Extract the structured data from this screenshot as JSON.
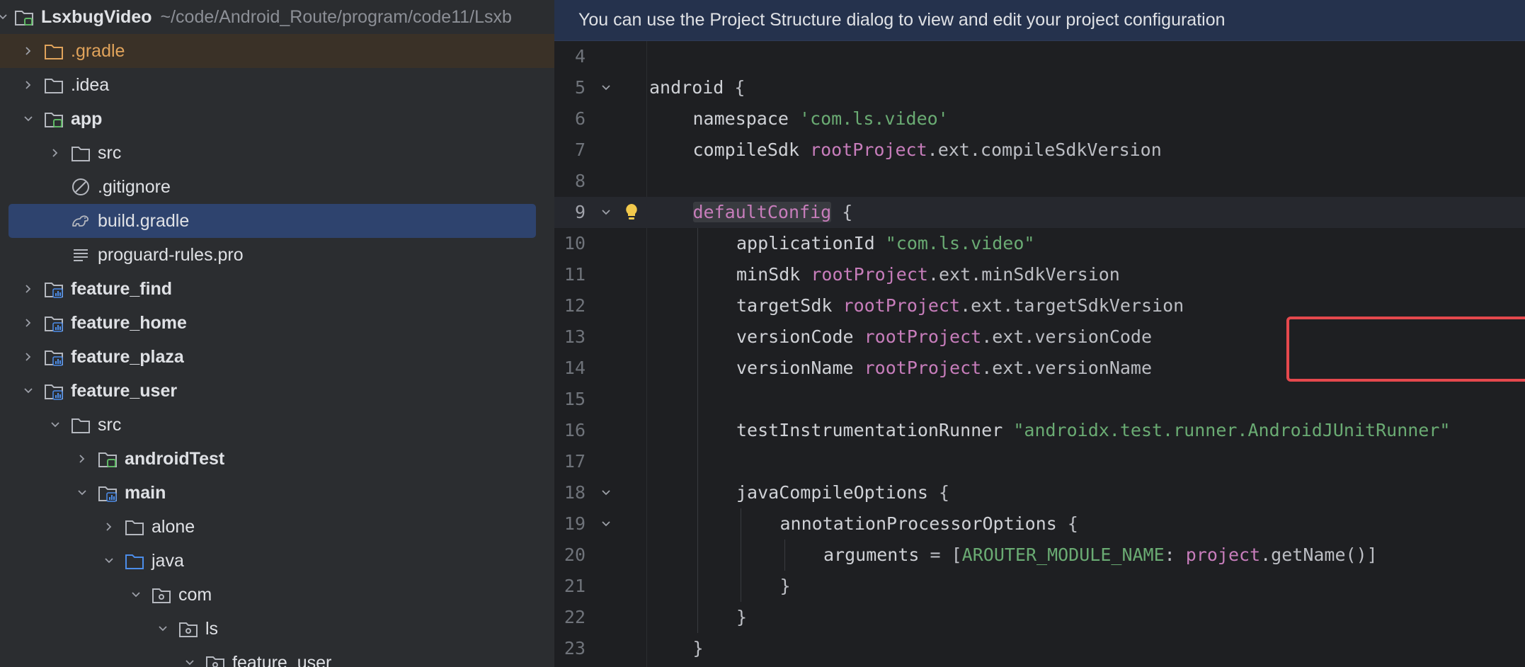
{
  "tree": {
    "root": {
      "label": "LsxbugVideo",
      "path": "~/code/Android_Route/program/code11/Lsxb"
    },
    "items": [
      {
        "label": ".gradle",
        "kind": "folder",
        "indent": 0,
        "expand": "collapsed",
        "style": "gradle"
      },
      {
        "label": ".idea",
        "kind": "folder",
        "indent": 0,
        "expand": "collapsed"
      },
      {
        "label": "app",
        "kind": "module",
        "indent": 0,
        "expand": "expanded",
        "bold": true
      },
      {
        "label": "src",
        "kind": "folder",
        "indent": 1,
        "expand": "collapsed"
      },
      {
        "label": ".gitignore",
        "kind": "ignore",
        "indent": 1,
        "expand": "none"
      },
      {
        "label": "build.gradle",
        "kind": "gradle-file",
        "indent": 1,
        "expand": "none",
        "selected": true
      },
      {
        "label": "proguard-rules.pro",
        "kind": "text-file",
        "indent": 1,
        "expand": "none"
      },
      {
        "label": "feature_find",
        "kind": "lib-module",
        "indent": 0,
        "expand": "collapsed",
        "bold": true
      },
      {
        "label": "feature_home",
        "kind": "lib-module",
        "indent": 0,
        "expand": "collapsed",
        "bold": true
      },
      {
        "label": "feature_plaza",
        "kind": "lib-module",
        "indent": 0,
        "expand": "collapsed",
        "bold": true
      },
      {
        "label": "feature_user",
        "kind": "lib-module",
        "indent": 0,
        "expand": "expanded",
        "bold": true
      },
      {
        "label": "src",
        "kind": "folder",
        "indent": 1,
        "expand": "expanded"
      },
      {
        "label": "androidTest",
        "kind": "test-folder",
        "indent": 2,
        "expand": "collapsed",
        "bold": true
      },
      {
        "label": "main",
        "kind": "lib-module",
        "indent": 2,
        "expand": "expanded",
        "bold": true
      },
      {
        "label": "alone",
        "kind": "folder",
        "indent": 3,
        "expand": "collapsed"
      },
      {
        "label": "java",
        "kind": "source-folder",
        "indent": 3,
        "expand": "expanded"
      },
      {
        "label": "com",
        "kind": "package",
        "indent": 4,
        "expand": "expanded"
      },
      {
        "label": "ls",
        "kind": "package",
        "indent": 5,
        "expand": "expanded"
      },
      {
        "label": "feature_user",
        "kind": "package",
        "indent": 6,
        "expand": "expanded"
      }
    ]
  },
  "editor": {
    "banner": "You can use the Project Structure dialog to view and edit your project configuration",
    "current_line": 9,
    "lines": [
      {
        "n": "4",
        "indent": 0,
        "tokens": []
      },
      {
        "n": "5",
        "indent": 0,
        "fold": true,
        "tokens": [
          [
            "kw",
            "android "
          ],
          [
            "plain",
            "{"
          ]
        ]
      },
      {
        "n": "6",
        "indent": 1,
        "tokens": [
          [
            "kw",
            "namespace "
          ],
          [
            "str",
            "'com.ls.video'"
          ]
        ]
      },
      {
        "n": "7",
        "indent": 1,
        "tokens": [
          [
            "kw",
            "compileSdk "
          ],
          [
            "ident",
            "rootProject"
          ],
          [
            "plain",
            ".ext.compileSdkVersion"
          ]
        ]
      },
      {
        "n": "8",
        "indent": 0,
        "tokens": []
      },
      {
        "n": "9",
        "indent": 1,
        "fold": true,
        "bulb": true,
        "tokens": [
          [
            "defcfg",
            "defaultConfig"
          ],
          [
            "plain",
            " {"
          ]
        ]
      },
      {
        "n": "10",
        "indent": 2,
        "tokens": [
          [
            "kw",
            "applicationId "
          ],
          [
            "str",
            "\"com.ls.video\""
          ]
        ]
      },
      {
        "n": "11",
        "indent": 2,
        "tokens": [
          [
            "kw",
            "minSdk "
          ],
          [
            "ident",
            "rootProject"
          ],
          [
            "plain",
            ".ext.minSdkVersion"
          ]
        ]
      },
      {
        "n": "12",
        "indent": 2,
        "tokens": [
          [
            "kw",
            "targetSdk "
          ],
          [
            "ident",
            "rootProject"
          ],
          [
            "plain",
            ".ext.targetSdkVersion"
          ]
        ]
      },
      {
        "n": "13",
        "indent": 2,
        "tokens": [
          [
            "kw",
            "versionCode "
          ],
          [
            "ident",
            "rootProject"
          ],
          [
            "plain",
            ".ext.versionCode"
          ]
        ]
      },
      {
        "n": "14",
        "indent": 2,
        "tokens": [
          [
            "kw",
            "versionName "
          ],
          [
            "ident",
            "rootProject"
          ],
          [
            "plain",
            ".ext.versionName"
          ]
        ]
      },
      {
        "n": "15",
        "indent": 0,
        "tokens": []
      },
      {
        "n": "16",
        "indent": 2,
        "tokens": [
          [
            "kw",
            "testInstrumentationRunner "
          ],
          [
            "str",
            "\"androidx.test.runner.AndroidJUnitRunner\""
          ]
        ]
      },
      {
        "n": "17",
        "indent": 0,
        "tokens": []
      },
      {
        "n": "18",
        "indent": 2,
        "fold": true,
        "tokens": [
          [
            "kw",
            "javaCompileOptions "
          ],
          [
            "plain",
            "{"
          ]
        ]
      },
      {
        "n": "19",
        "indent": 3,
        "fold": true,
        "tokens": [
          [
            "kw",
            "annotationProcessorOptions "
          ],
          [
            "plain",
            "{"
          ]
        ]
      },
      {
        "n": "20",
        "indent": 4,
        "tokens": [
          [
            "kw",
            "arguments "
          ],
          [
            "plain",
            "= ["
          ],
          [
            "str",
            "AROUTER_MODULE_NAME"
          ],
          [
            "plain",
            ": "
          ],
          [
            "ident",
            "project"
          ],
          [
            "plain",
            ".getName()]"
          ]
        ]
      },
      {
        "n": "21",
        "indent": 3,
        "tokens": [
          [
            "plain",
            "}"
          ]
        ]
      },
      {
        "n": "22",
        "indent": 2,
        "tokens": [
          [
            "plain",
            "}"
          ]
        ]
      },
      {
        "n": "23",
        "indent": 1,
        "tokens": [
          [
            "plain",
            "}"
          ]
        ]
      }
    ]
  },
  "colors": {
    "accent_selection": "#2e436e",
    "highlight_box": "#e5484d",
    "string": "#6aab73",
    "identifier": "#c77dbb",
    "gradle_folder": "#e0a35b"
  }
}
